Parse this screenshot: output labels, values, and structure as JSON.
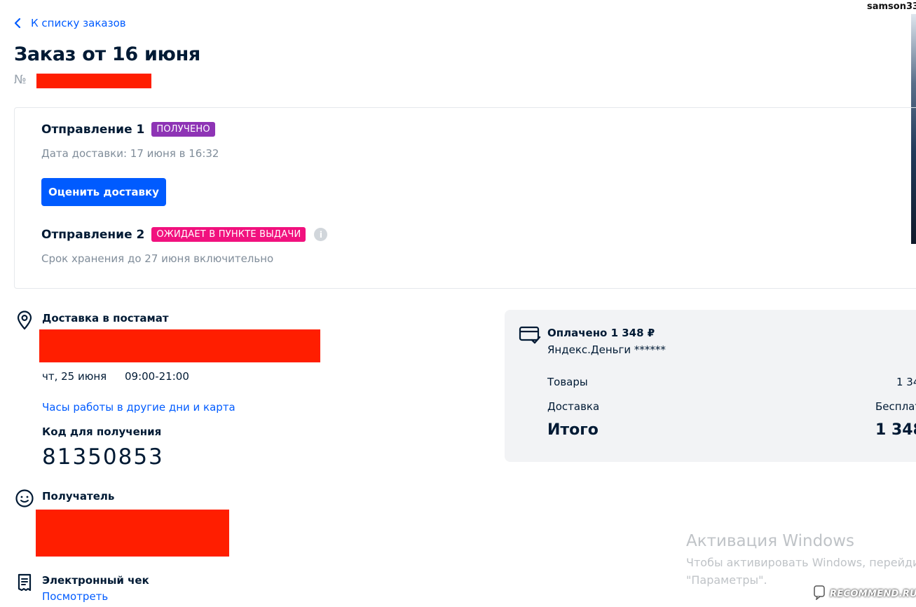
{
  "header": {
    "back_link": "К списку заказов",
    "title": "Заказ от 16 июня",
    "order_number_prefix": "№",
    "username": "samson33"
  },
  "shipments": [
    {
      "title": "Отправление 1",
      "status": "ПОЛУЧЕНО",
      "status_color": "#8e34b5",
      "detail": "Дата доставки: 17 июня в 16:32",
      "action_label": "Оценить доставку"
    },
    {
      "title": "Отправление 2",
      "status": "ОЖИДАЕТ В ПУНКТЕ ВЫДАЧИ",
      "status_color": "#f1117e",
      "detail": "Срок хранения до 27 июня включительно"
    }
  ],
  "delivery": {
    "title": "Доставка в постамат",
    "date": "чт, 25 июня",
    "hours": "09:00-21:00",
    "hours_link": "Часы работы в другие дни и карта",
    "code_label": "Код для получения",
    "code": "81350853"
  },
  "recipient": {
    "title": "Получатель"
  },
  "receipt": {
    "title": "Электронный чек",
    "link": "Посмотреть"
  },
  "payment": {
    "title": "Оплачено 1 348 ₽",
    "method": "Яндекс.Деньги ******",
    "rows": [
      {
        "label": "Товары",
        "value": "1 34"
      },
      {
        "label": "Доставка",
        "value": "Бесплат"
      }
    ],
    "total_label": "Итого",
    "total_value": "1 348"
  },
  "windows": {
    "title": "Активация Windows",
    "line1": "Чтобы активировать Windows, перейди",
    "line2": "\"Параметры\"."
  },
  "watermark": "RECOMMEND.RU",
  "colors": {
    "accent": "#005bff",
    "text": "#001a34",
    "muted": "#808d9a",
    "redaction": "#ff1e00"
  },
  "icons": [
    "chevron-left-icon",
    "location-pin-icon",
    "smiley-icon",
    "receipt-icon",
    "card-check-icon",
    "info-icon"
  ]
}
